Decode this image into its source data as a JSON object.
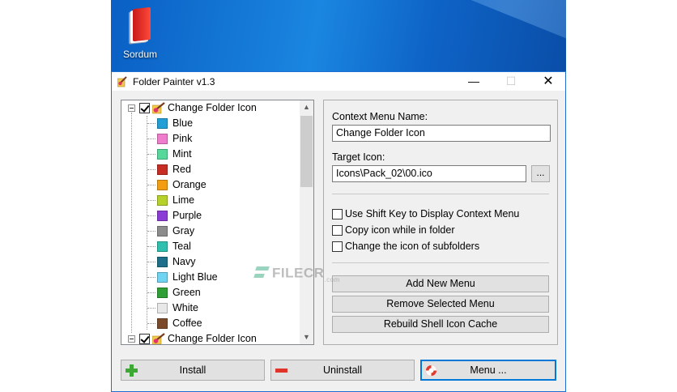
{
  "desktop": {
    "icon_label": "Sordum",
    "icon": "red-book-icon"
  },
  "window": {
    "title": "Folder Painter v1.3",
    "controls": {
      "minimize": "—",
      "maximize": "☐",
      "close": "✕"
    }
  },
  "tree": {
    "root_label": "Change Folder Icon",
    "items": [
      {
        "label": "Blue",
        "color": "#1f9fd6"
      },
      {
        "label": "Pink",
        "color": "#f07ccd"
      },
      {
        "label": "Mint",
        "color": "#55d89a"
      },
      {
        "label": "Red",
        "color": "#c72d23"
      },
      {
        "label": "Orange",
        "color": "#f39d12"
      },
      {
        "label": "Lime",
        "color": "#b6d12a"
      },
      {
        "label": "Purple",
        "color": "#8b3bd6"
      },
      {
        "label": "Gray",
        "color": "#8c8c8c"
      },
      {
        "label": "Teal",
        "color": "#2fbfae"
      },
      {
        "label": "Navy",
        "color": "#1d6f8a"
      },
      {
        "label": "Light Blue",
        "color": "#6fd3f2"
      },
      {
        "label": "Green",
        "color": "#2e9f35"
      },
      {
        "label": "White",
        "color": "#e8e8e8"
      },
      {
        "label": "Coffee",
        "color": "#7a4a2a"
      }
    ],
    "second_root_label": "Change Folder Icon"
  },
  "panel": {
    "context_menu_label": "Context Menu Name:",
    "context_menu_value": "Change Folder Icon",
    "target_icon_label": "Target Icon:",
    "target_icon_value": "Icons\\Pack_02\\00.ico",
    "browse_label": "...",
    "options": [
      "Use Shift Key to Display Context Menu",
      "Copy icon while in folder",
      "Change the icon of subfolders"
    ],
    "add_menu": "Add New Menu",
    "remove_menu": "Remove Selected Menu",
    "rebuild_cache": "Rebuild Shell Icon Cache"
  },
  "buttons": {
    "install": "Install",
    "uninstall": "Uninstall",
    "menu": "Menu ..."
  },
  "watermark": {
    "text": "FILECR",
    "sub": ".com"
  }
}
